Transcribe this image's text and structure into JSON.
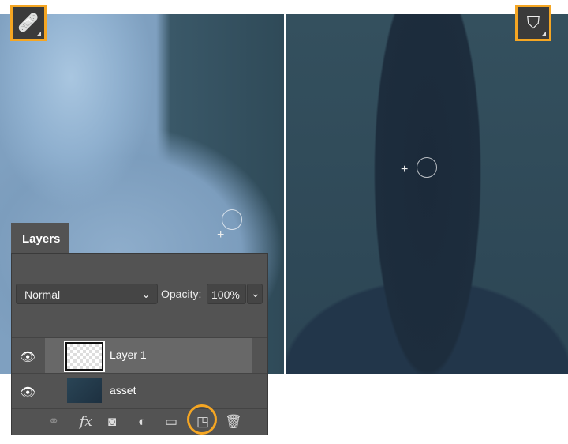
{
  "tools": {
    "left": {
      "icon": "healing-brush-icon"
    },
    "right": {
      "icon": "clone-stamp-icon"
    }
  },
  "layers_panel": {
    "tab_label": "Layers",
    "blend_mode": "Normal",
    "opacity_label": "Opacity:",
    "opacity_value": "100%",
    "layers": [
      {
        "name": "Layer 1",
        "visible": true,
        "selected": true
      },
      {
        "name": "asset",
        "visible": true,
        "selected": false
      }
    ],
    "footer_icons": [
      "link-icon",
      "fx-icon",
      "mask-icon",
      "adjustment-icon",
      "folder-icon",
      "new-layer-icon",
      "trash-icon"
    ],
    "fx_label": "fx",
    "highlighted_icon": "new-layer-icon",
    "highlight_color": "#f5a623"
  }
}
